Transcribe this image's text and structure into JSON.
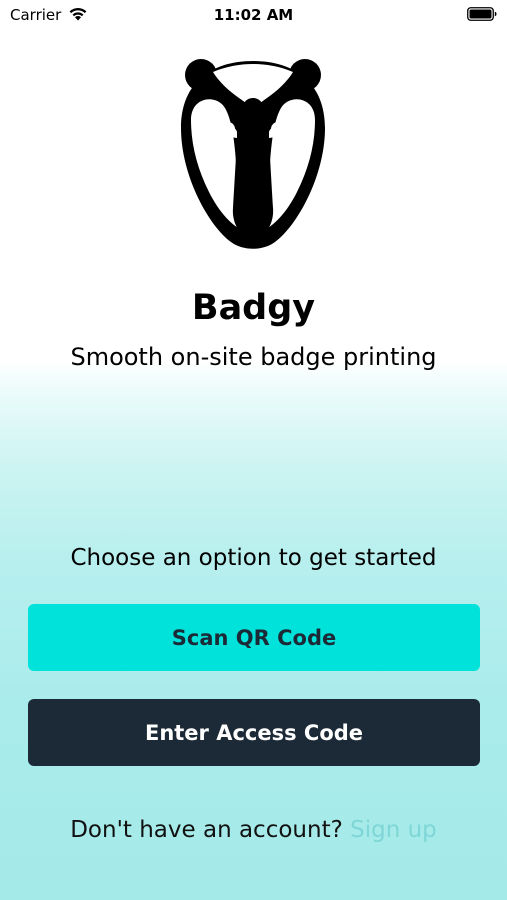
{
  "status_bar": {
    "carrier": "Carrier",
    "time": "11:02 AM",
    "wifi_icon": "wifi-icon",
    "battery_icon": "battery-icon"
  },
  "brand": {
    "logo_icon": "badger-logo",
    "title": "Badgy",
    "tagline": "Smooth on-site badge printing"
  },
  "onboarding": {
    "prompt": "Choose an option to get started",
    "scan_button_label": "Scan QR Code",
    "access_button_label": "Enter Access Code"
  },
  "signup": {
    "question": "Don't have an account?",
    "link_label": "Sign up"
  },
  "colors": {
    "scan_button": "#00e2da",
    "access_button": "#1b2a36",
    "link": "#7fd6d6"
  }
}
